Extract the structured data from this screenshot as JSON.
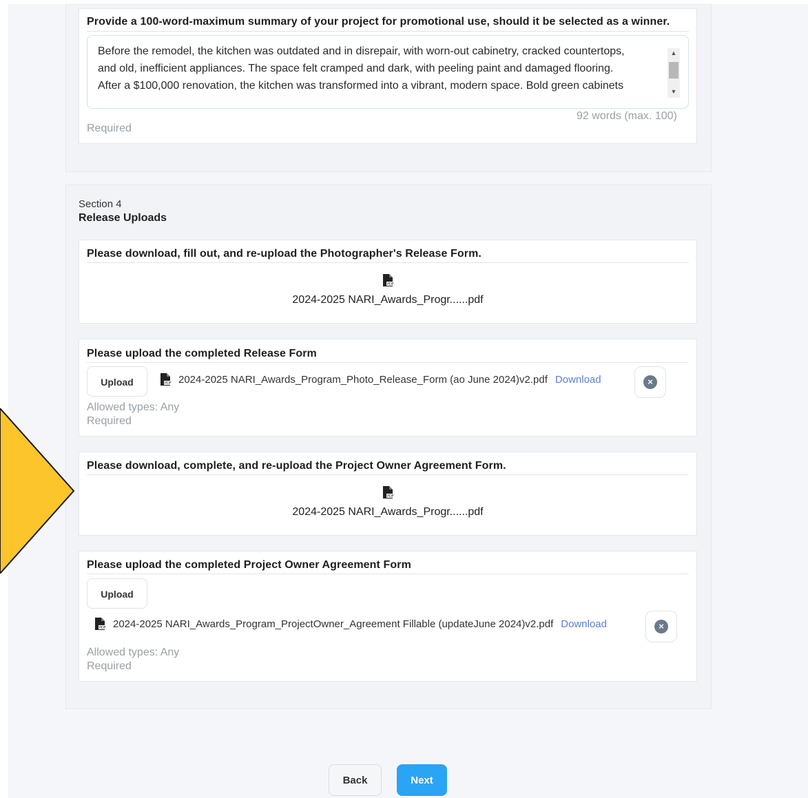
{
  "summary": {
    "prompt": "Provide a 100-word-maximum summary of your project for promotional use, should it be selected as a winner.",
    "text": "Before the remodel, the kitchen was outdated and in disrepair, with worn-out cabinetry, cracked countertops,\nand old, inefficient appliances. The space felt cramped and dark, with peeling paint and damaged flooring.\nAfter a $100,000 renovation, the kitchen was transformed into a vibrant, modern space. Bold green cabinets",
    "word_count": "92  words  (max. 100)",
    "required": "Required"
  },
  "section4": {
    "label": "Section 4",
    "title": "Release Uploads",
    "photo_release_download": {
      "prompt": "Please download, fill out, and re-upload the Photographer's Release Form.",
      "file": "2024-2025 NARI_Awards_Progr......pdf"
    },
    "photo_release_upload": {
      "prompt": "Please upload the completed Release Form",
      "upload_label": "Upload",
      "file": "2024-2025 NARI_Awards_Program_Photo_Release_Form (ao June 2024)v2.pdf",
      "download_label": "Download",
      "allowed": "Allowed types:  Any",
      "required": "Required"
    },
    "owner_agreement_download": {
      "prompt": "Please download, complete, and re-upload the Project Owner Agreement Form.",
      "file": "2024-2025 NARI_Awards_Progr......pdf"
    },
    "owner_agreement_upload": {
      "prompt": "Please upload the completed Project Owner Agreement Form",
      "upload_label": "Upload",
      "file": "2024-2025 NARI_Awards_Program_ProjectOwner_Agreement Fillable (updateJune 2024)v2.pdf",
      "download_label": "Download",
      "allowed": "Allowed types:  Any",
      "required": "Required"
    }
  },
  "nav": {
    "back_label": "Back",
    "next_label": "Next"
  },
  "colors": {
    "accent": "#2aa4f4",
    "link": "#5b7fd6",
    "arrow": "#fcc52b"
  }
}
